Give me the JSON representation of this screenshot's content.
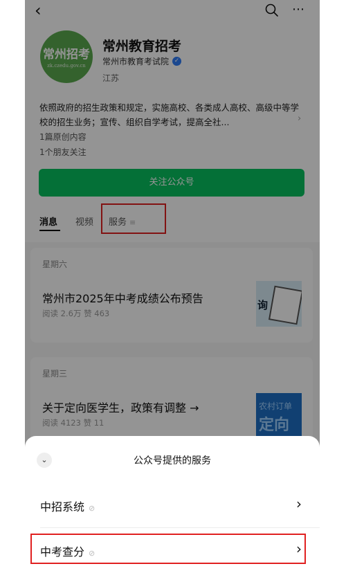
{
  "topbar": {
    "back_glyph": "‹",
    "search_icon": "search-icon",
    "more_glyph": "⋯"
  },
  "profile": {
    "logo_text": "常州招考",
    "logo_url": "zk.czedu.gov.cn",
    "account_name": "常州教育招考",
    "organization": "常州市教育考试院",
    "verified_glyph": "✓",
    "region": "江苏",
    "description": "依照政府的招生政策和规定，实施高校、各类成人高校、高级中等学校的招生业务；宣传、组织自学考试，提高全社...",
    "description_arrow": "›",
    "original_count": "1篇原创内容",
    "friends_following": "1个朋友关注",
    "follow_label": "关注公众号"
  },
  "tabs": {
    "messages": "消息",
    "videos": "视频",
    "services": "服务",
    "services_menu_glyph": "≡"
  },
  "articles": [
    {
      "date": "星期六",
      "title": "常州市2025年中考成绩公布预告",
      "meta": "阅读 2.6万  赞 463",
      "thumb_label": "询"
    },
    {
      "date": "星期三",
      "title": "关于定向医学生，政策有调整 →",
      "meta": "阅读 4123  赞 11",
      "thumb_line1": "农村订单",
      "thumb_line2": "定向"
    }
  ],
  "sheet": {
    "collapse_glyph": "⌄",
    "title": "公众号提供的服务",
    "items": [
      {
        "label": "中招系统",
        "link_glyph": "⊘",
        "chevron": "›"
      },
      {
        "label": "中考查分",
        "link_glyph": "⊘",
        "chevron": "›"
      }
    ]
  },
  "colors": {
    "follow_button": "#07c160",
    "highlight": "#e02020",
    "verified": "#2f7cf6",
    "avatar": "#5aaa4f"
  }
}
